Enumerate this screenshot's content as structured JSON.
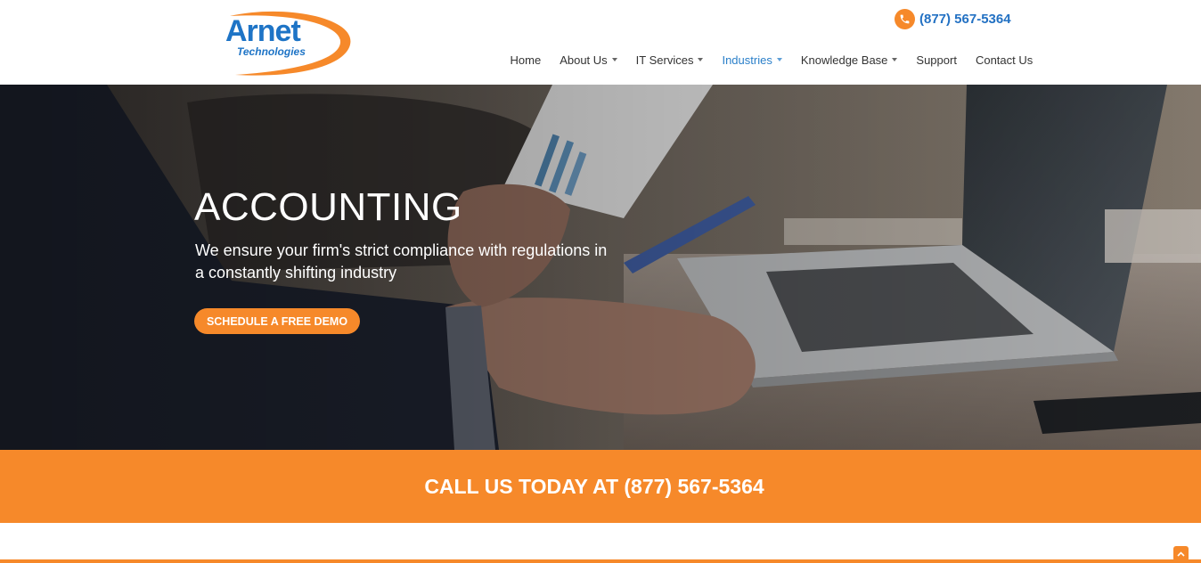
{
  "brand": {
    "logo_line1": "Arnet",
    "logo_line2": "Technologies",
    "colors": {
      "orange": "#f6892a",
      "blue": "#1e74c6",
      "nav_active": "#2a7fc9"
    }
  },
  "header": {
    "phone_icon": "phone-icon",
    "phone": "(877) 567-5364"
  },
  "nav": {
    "items": [
      {
        "label": "Home"
      },
      {
        "label": "About Us",
        "dropdown": true
      },
      {
        "label": "IT Services",
        "dropdown": true
      },
      {
        "label": "Industries",
        "dropdown": true,
        "active": true
      },
      {
        "label": "Knowledge Base",
        "dropdown": true
      },
      {
        "label": "Support"
      },
      {
        "label": "Contact Us"
      }
    ]
  },
  "hero": {
    "title": "ACCOUNTING",
    "subtitle": "We ensure your firm's strict compliance with regulations in a constantly shifting industry",
    "button": "SCHEDULE A FREE DEMO"
  },
  "banner": {
    "text": "CALL US TODAY AT (877) 567-5364"
  },
  "footer": {
    "scroll_icon": "chevron-up-icon"
  }
}
